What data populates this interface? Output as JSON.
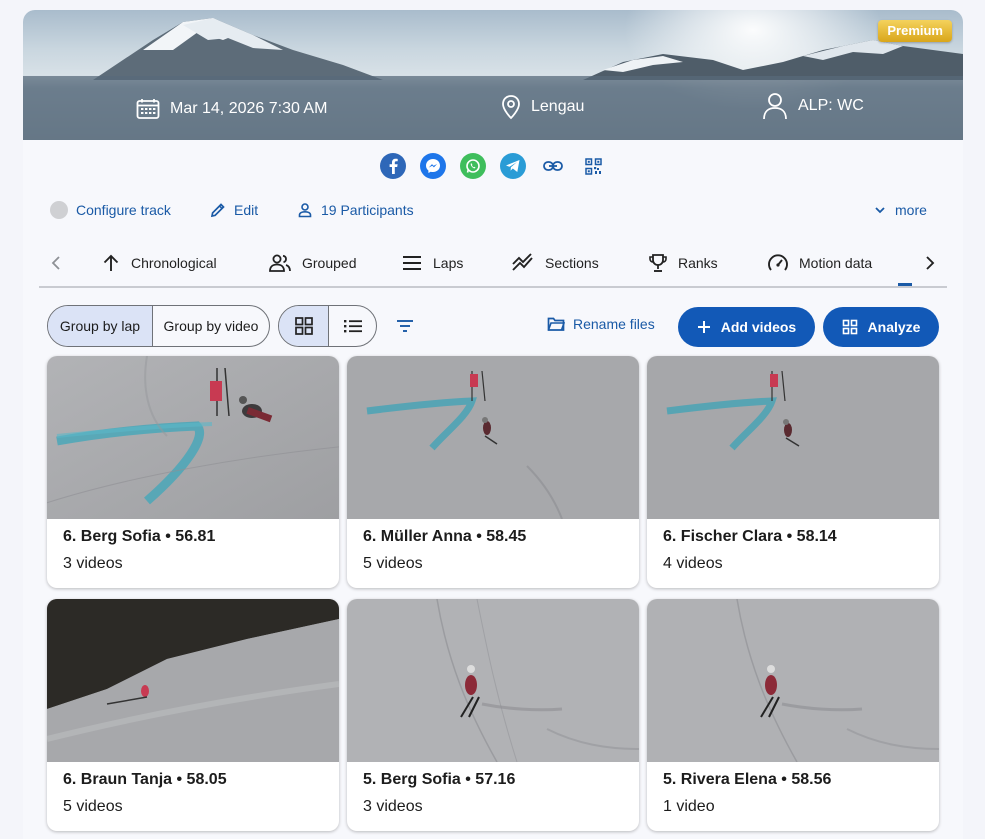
{
  "header": {
    "badge": "Premium",
    "date": "Mar 14, 2026 7:30 AM",
    "location": "Lengau",
    "category": "ALP: WC"
  },
  "share": {
    "icons": [
      "facebook-icon",
      "messenger-icon",
      "whatsapp-icon",
      "telegram-icon",
      "link-icon",
      "qr-code-icon"
    ]
  },
  "actions": {
    "configure": "Configure track",
    "edit": "Edit",
    "participants": "19 Participants",
    "more": "more"
  },
  "tabs": [
    {
      "label": "Chronological",
      "icon": "arrow-up-icon"
    },
    {
      "label": "Grouped",
      "icon": "people-icon"
    },
    {
      "label": "Laps",
      "icon": "menu-lines-icon"
    },
    {
      "label": "Sections",
      "icon": "trend-icon"
    },
    {
      "label": "Ranks",
      "icon": "trophy-icon"
    },
    {
      "label": "Motion data",
      "icon": "speedometer-icon"
    }
  ],
  "toolbar": {
    "group_by_lap": "Group by lap",
    "group_by_video": "Group by video",
    "rename": "Rename files",
    "add_videos": "Add videos",
    "analyze": "Analyze"
  },
  "videos": [
    {
      "title": "6. Berg Sofia • 56.81",
      "count": "3 videos"
    },
    {
      "title": "6. Müller Anna • 58.45",
      "count": "5 videos"
    },
    {
      "title": "6. Fischer Clara • 58.14",
      "count": "4 videos"
    },
    {
      "title": "6. Braun Tanja • 58.05",
      "count": "5 videos"
    },
    {
      "title": "5. Berg Sofia • 57.16",
      "count": "3 videos"
    },
    {
      "title": "5. Rivera Elena • 58.56",
      "count": "1 video"
    }
  ],
  "colors": {
    "accent": "#1259b7",
    "link": "#1a5aa6",
    "premium": "#d9a61a"
  }
}
